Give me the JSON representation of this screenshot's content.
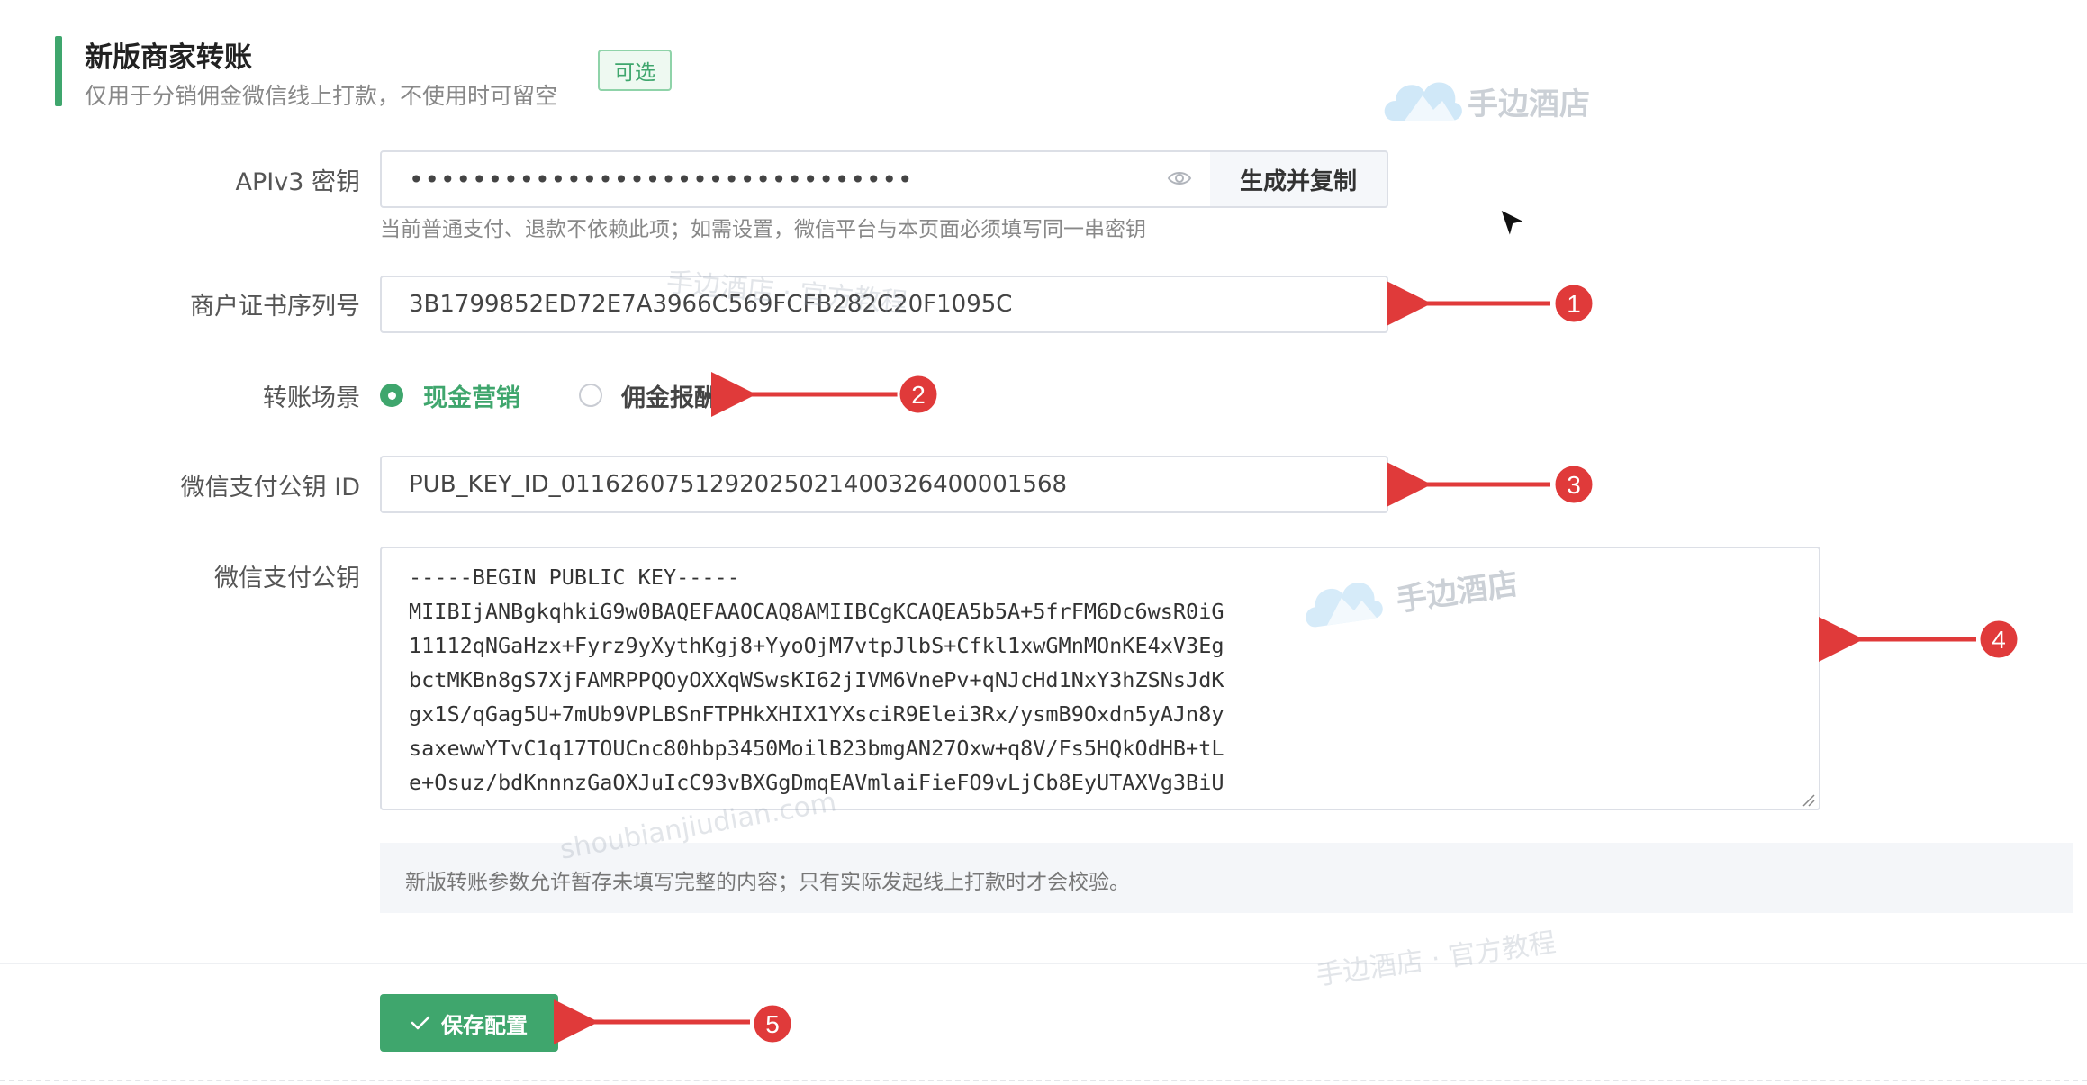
{
  "section": {
    "title": "新版商家转账",
    "description": "仅用于分销佣金微信线上打款，不使用时可留空",
    "badge": "可选"
  },
  "apiv3": {
    "label": "APIv3 密钥",
    "masked_value": "••••••••••••••••••••••••••••••••",
    "generate_label": "生成并复制",
    "help": "当前普通支付、退款不依赖此项；如需设置，微信平台与本页面必须填写同一串密钥"
  },
  "serial": {
    "label": "商户证书序列号",
    "value": "3B1799852ED72E7A3966C569FCFB282C20F1095C"
  },
  "scene": {
    "label": "转账场景",
    "options": [
      {
        "label": "现金营销",
        "selected": true
      },
      {
        "label": "佣金报酬",
        "selected": false
      }
    ]
  },
  "pubkey_id": {
    "label": "微信支付公钥 ID",
    "value": "PUB_KEY_ID_0116260751292025021400326400001568"
  },
  "pubkey": {
    "label": "微信支付公钥",
    "lines": [
      "-----BEGIN PUBLIC KEY-----",
      "MIIBIjANBgkqhkiG9w0BAQEFAAOCAQ8AMIIBCgKCAQEA5b5A+5frFM6Dc6wsR0iG",
      "11112qNGaHzx+Fyrz9yXythKgj8+YyoOjM7vtpJlbS+Cfkl1xwGMnMOnKE4xV3Eg",
      "bctMKBn8gS7XjFAMRPPQOyOXXqWSwsKI62jIVM6VnePv+qNJcHd1NxY3hZSNsJdK",
      "gx1S/qGag5U+7mUb9VPLBSnFTPHkXHIX1YXsciR9Elei3Rx/ysmB9Oxdn5yAJn8y",
      "saxewwYTvC1q17TOUCnc80hbp3450MoilB23bmgAN27Oxw+q8V/Fs5HQkOdHB+tL",
      "e+Osuz/bdKnnnzGaOXJuIcC93vBXGgDmqEAVmlaiFieFO9vLjCb8EyUTAXVg3BiU"
    ]
  },
  "note": "新版转账参数允许暂存未填写完整的内容；只有实际发起线上打款时才会校验。",
  "save_label": "保存配置",
  "annotations": [
    "1",
    "2",
    "3",
    "4",
    "5"
  ],
  "watermarks": {
    "logo_text": "手边酒店",
    "tutorial": "手边酒店 · 官方教程",
    "domain": "shoubianjiudian.com"
  },
  "colors": {
    "accent": "#3fa66d",
    "annotation": "#e03a3a"
  }
}
